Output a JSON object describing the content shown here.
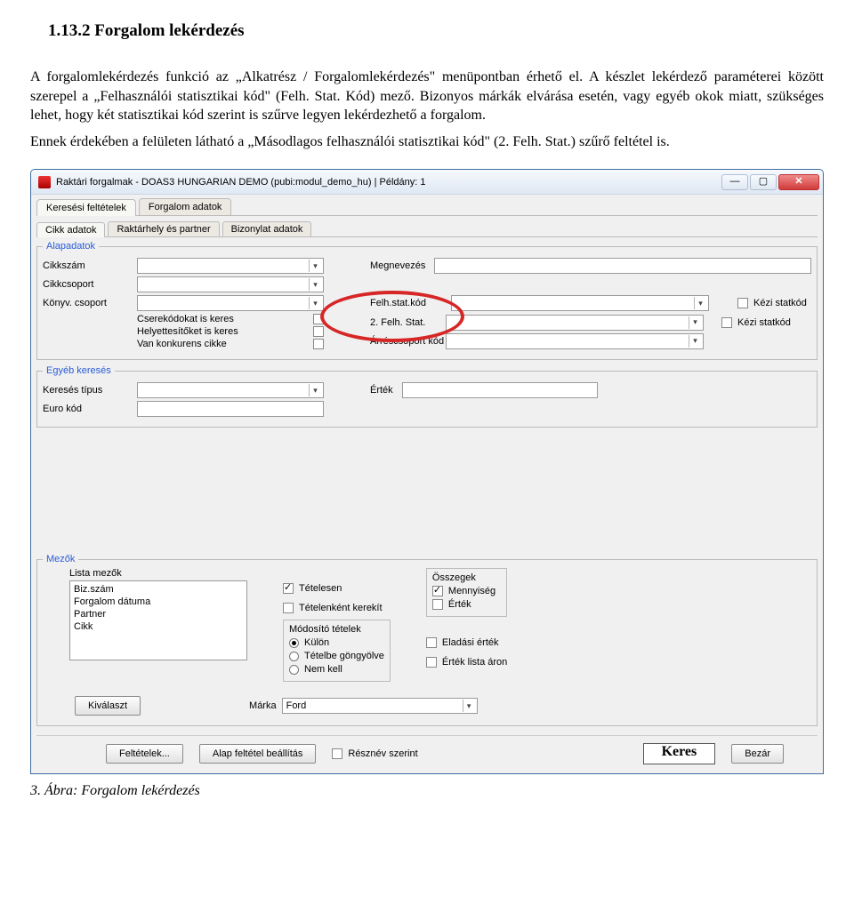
{
  "doc": {
    "heading": "1.13.2  Forgalom lekérdezés",
    "p1": "A forgalomlekérdezés funkció az „Alkatrész / Forgalomlekérdezés\" menüpontban érhető el. A készlet lekérdező paraméterei között szerepel a „Felhasználói statisztikai kód\" (Felh. Stat. Kód) mező. Bizonyos márkák elvárása esetén, vagy egyéb okok miatt, szükséges lehet, hogy két statisztikai kód szerint is szűrve legyen lekérdezhető a forgalom.",
    "p2": "Ennek érdekében a felületen látható a „Másodlagos felhasználói statisztikai kód\" (2. Felh. Stat.) szűrő feltétel is.",
    "fig_caption": "3. Ábra: Forgalom lekérdezés"
  },
  "win": {
    "title": "Raktári forgalmak - DOAS3 HUNGARIAN DEMO (pubi:modul_demo_hu) | Példány: 1",
    "tabs_top": [
      "Keresési feltételek",
      "Forgalom adatok"
    ],
    "tabs_sub": [
      "Cikk adatok",
      "Raktárhely és partner",
      "Bizonylat adatok"
    ],
    "grp_alap": "Alapadatok",
    "labels": {
      "cikkszam": "Cikkszám",
      "megnevezes": "Megnevezés",
      "cikkcsoport": "Cikkcsoport",
      "konyv": "Könyv. csoport",
      "felhstat": "Felh.stat.kód",
      "felhstat2": "2. Felh. Stat.",
      "kezik": "Kézi statkód",
      "arrescsoport": "Árréscsoport kód",
      "csere": "Cserekódokat is keres",
      "helyett": "Helyettesítőket is keres",
      "konkurens": "Van konkurens cikke"
    },
    "grp_egyeb": "Egyéb keresés",
    "egyeb": {
      "tipus": "Keresés típus",
      "ertek": "Érték",
      "euro": "Euro kód"
    },
    "grp_mezok": "Mezők",
    "mezok": {
      "list_label": "Lista mezők",
      "list_items": [
        "Biz.szám",
        "Forgalom dátuma",
        "Partner",
        "Cikk"
      ],
      "tetelesen": "Tételesen",
      "tet_kerekit": "Tételenként kerekít",
      "mod_title": "Módosító tételek",
      "mod_opts": [
        "Külön",
        "Tételbe göngyölve",
        "Nem kell"
      ],
      "osszeg_title": "Összegek",
      "mennyiseg": "Mennyiség",
      "ertek": "Érték",
      "eladasi": "Eladási érték",
      "listaaron": "Érték lista áron",
      "kivalaszt": "Kiválaszt",
      "marka_label": "Márka",
      "marka_value": "Ford"
    },
    "bottom": {
      "feltetelek": "Feltételek...",
      "alap": "Alap feltétel beállítás",
      "resznev": "Résznév szerint",
      "keres": "Keres",
      "bezar": "Bezár"
    }
  }
}
